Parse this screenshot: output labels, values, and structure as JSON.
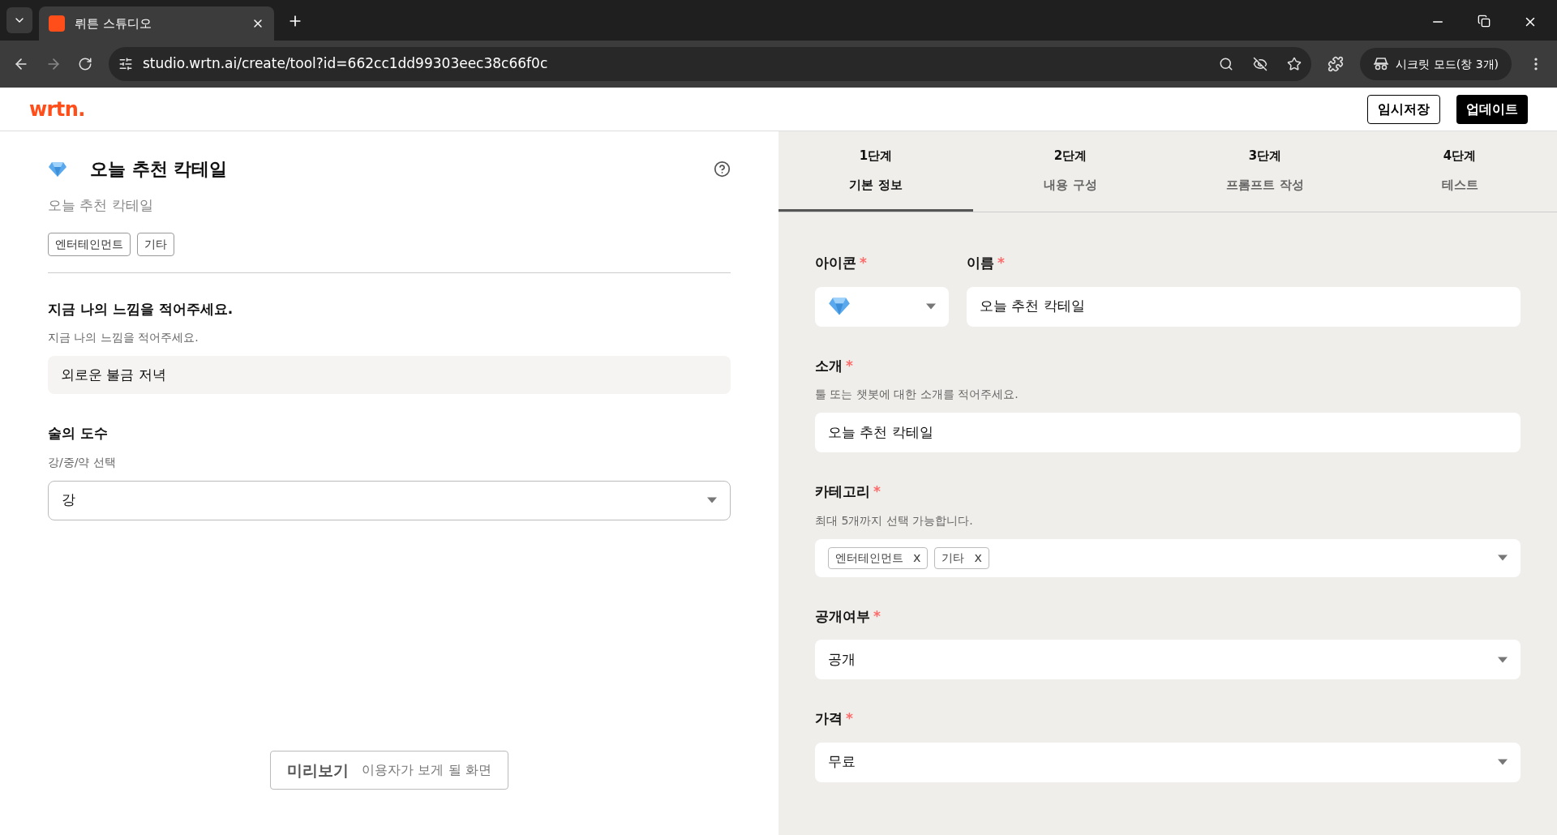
{
  "browser": {
    "tabs": [
      {
        "title": "뤼튼 스튜디오",
        "selected": true
      }
    ],
    "url": "studio.wrtn.ai/create/tool?id=662cc1dd99303eec38c66f0c",
    "profile": "시크릿 모드(창 3개)"
  },
  "header": {
    "logo": "wrtn.",
    "buttons": [
      {
        "label": "임시저장",
        "kind": "outline"
      },
      {
        "label": "업데이트",
        "kind": "solid"
      }
    ]
  },
  "preview": {
    "title": "오늘 추천 칵테일",
    "subtitle": "오늘 추천 칵테일",
    "tags": [
      "엔터테인먼트",
      "기타"
    ],
    "fields": [
      {
        "kind": "text",
        "label": "지금 나의 느낌을 적어주세요.",
        "hint": "지금 나의 느낌을 적어주세요.",
        "value": "외로운 불금 저녁"
      },
      {
        "kind": "select",
        "label": "술의 도수",
        "hint": "강/중/약 선택",
        "value": "강"
      }
    ],
    "button": {
      "label": "미리보기",
      "caption": "이용자가 보게 될 화면"
    }
  },
  "steps": [
    {
      "step": "1단계",
      "label": "기본 정보",
      "selected": true
    },
    {
      "step": "2단계",
      "label": "내용 구성",
      "selected": false
    },
    {
      "step": "3단계",
      "label": "프롬프트 작성",
      "selected": false
    },
    {
      "step": "4단계",
      "label": "테스트",
      "selected": false
    }
  ],
  "form": {
    "icon": {
      "label": "아이콘",
      "mark": "*"
    },
    "name": {
      "label": "이름",
      "mark": "*",
      "value": "오늘 추천 칵테일"
    },
    "fields": [
      {
        "kind": "text",
        "label": "소개",
        "mark": "*",
        "hint": "툴 또는 챗봇에 대한 소개를 적어주세요.",
        "value": "오늘 추천 칵테일"
      },
      {
        "kind": "tags",
        "label": "카테고리",
        "mark": "*",
        "hint": "최대 5개까지 선택 가능합니다.",
        "tags": [
          {
            "label": "엔터테인먼트",
            "remove": "x"
          },
          {
            "label": "기타",
            "remove": "x"
          }
        ]
      },
      {
        "kind": "select",
        "label": "공개여부",
        "mark": "*",
        "value": "공개"
      },
      {
        "kind": "select",
        "label": "가격",
        "mark": "*",
        "value": "무료"
      }
    ]
  }
}
